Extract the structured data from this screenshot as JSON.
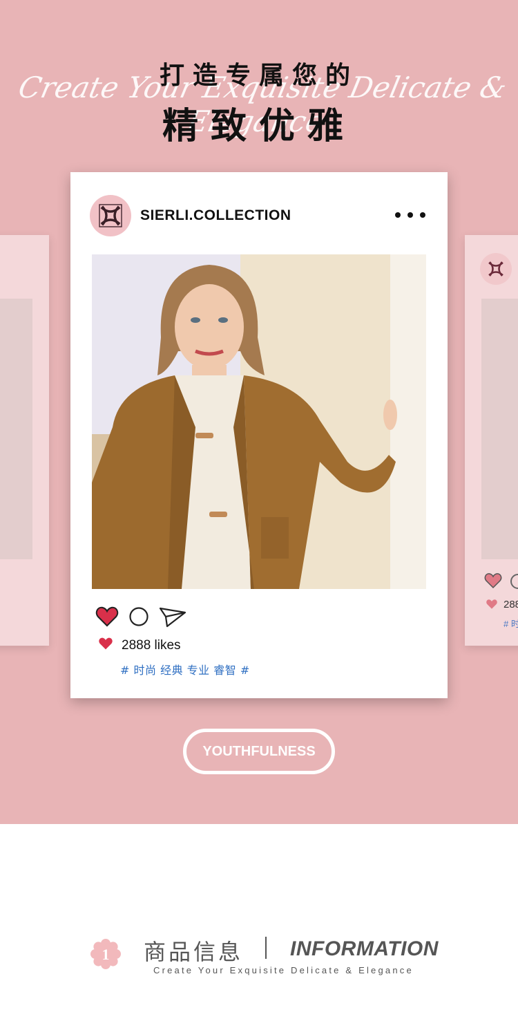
{
  "hero": {
    "title_cn_1": "打造专属您的",
    "title_script": "Create Your Exquisite Delicate & Elegance",
    "title_cn_2": "精致优雅"
  },
  "post": {
    "account": "SIERLI.COLLECTION",
    "more_icon": "more-dots-icon",
    "likes": "2888 likes",
    "tags": "# 时尚 经典 专业 睿智 #",
    "icons": [
      "heart-icon",
      "comment-icon",
      "send-icon"
    ]
  },
  "ghost_right": {
    "likes": "288",
    "tags": "# 时"
  },
  "pill_label": "YOUTHFULNESS",
  "info": {
    "badge_number": "1",
    "title_cn": "商品信息",
    "title_en": "INFORMATION",
    "subtitle": "Create Your Exquisite Delicate & Elegance"
  },
  "colors": {
    "hero_bg": "#e8b4b6",
    "heart_red": "#d9304a",
    "tag_blue": "#2f6fc2",
    "avatar_pink": "#f1c1c6"
  }
}
